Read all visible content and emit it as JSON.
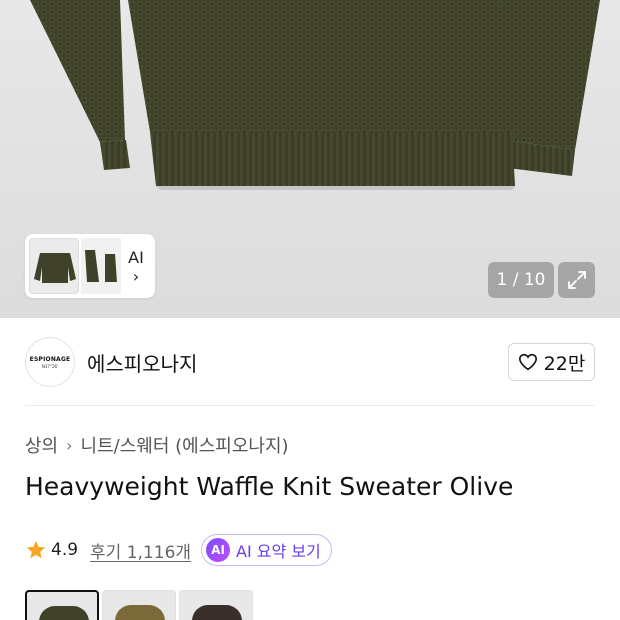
{
  "gallery": {
    "pager_text": "1 / 10",
    "ai_label": "AI",
    "ai_chevron": "›",
    "sweater_color": "#3f4129"
  },
  "brand": {
    "logo_line1": "ESPIONAGE",
    "logo_line2": "N37°26'",
    "name": "에스피오나지",
    "likes": "22만"
  },
  "breadcrumb": {
    "level1": "상의",
    "level2": "니트/스웨터 (에스피오나지)",
    "separator": "›"
  },
  "product": {
    "title": "Heavyweight Waffle Knit Sweater Olive"
  },
  "rating": {
    "value": "4.9",
    "reviews": "후기 1,116개",
    "ai_badge": "AI",
    "ai_summary_label": "AI 요약 보기",
    "star_color": "#f5a623"
  },
  "colors": {
    "swatches": [
      {
        "name": "olive",
        "color": "#3f4129",
        "selected": true
      },
      {
        "name": "khaki",
        "color": "#7a6a3a",
        "selected": false
      },
      {
        "name": "brown",
        "color": "#3a2f2a",
        "selected": false
      }
    ]
  }
}
